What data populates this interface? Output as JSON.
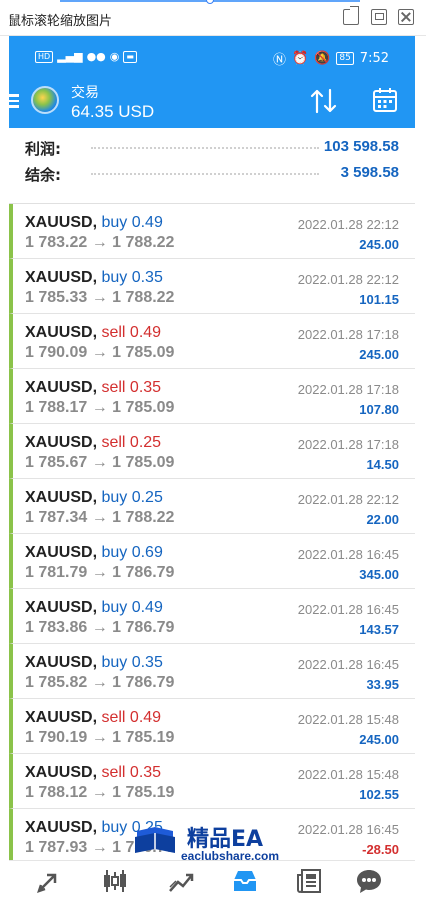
{
  "viewer": {
    "title": "鼠标滚轮缩放图片"
  },
  "status_bar": {
    "left_text": "HD 46 .ıl",
    "time": "7:52",
    "battery": "85"
  },
  "app_bar": {
    "title": "交易",
    "balance": "64.35 USD"
  },
  "summary": {
    "profit_label": "利润:",
    "profit_value": "103 598.58",
    "balance_label": "结余:",
    "balance_value": "3 598.58"
  },
  "orders": [
    {
      "symbol": "XAUUSD,",
      "side": "buy 0.49",
      "type": "buy",
      "prices": "1 783.22 → 1 788.22",
      "time": "2022.01.28 22:12",
      "profit": "245.00"
    },
    {
      "symbol": "XAUUSD,",
      "side": "buy 0.35",
      "type": "buy",
      "prices": "1 785.33 → 1 788.22",
      "time": "2022.01.28 22:12",
      "profit": "101.15"
    },
    {
      "symbol": "XAUUSD,",
      "side": "sell 0.49",
      "type": "sell",
      "prices": "1 790.09 → 1 785.09",
      "time": "2022.01.28 17:18",
      "profit": "245.00"
    },
    {
      "symbol": "XAUUSD,",
      "side": "sell 0.35",
      "type": "sell",
      "prices": "1 788.17 → 1 785.09",
      "time": "2022.01.28 17:18",
      "profit": "107.80"
    },
    {
      "symbol": "XAUUSD,",
      "side": "sell 0.25",
      "type": "sell",
      "prices": "1 785.67 → 1 785.09",
      "time": "2022.01.28 17:18",
      "profit": "14.50"
    },
    {
      "symbol": "XAUUSD,",
      "side": "buy 0.25",
      "type": "buy",
      "prices": "1 787.34 → 1 788.22",
      "time": "2022.01.28 22:12",
      "profit": "22.00"
    },
    {
      "symbol": "XAUUSD,",
      "side": "buy 0.69",
      "type": "buy",
      "prices": "1 781.79 → 1 786.79",
      "time": "2022.01.28 16:45",
      "profit": "345.00"
    },
    {
      "symbol": "XAUUSD,",
      "side": "buy 0.49",
      "type": "buy",
      "prices": "1 783.86 → 1 786.79",
      "time": "2022.01.28 16:45",
      "profit": "143.57"
    },
    {
      "symbol": "XAUUSD,",
      "side": "buy 0.35",
      "type": "buy",
      "prices": "1 785.82 → 1 786.79",
      "time": "2022.01.28 16:45",
      "profit": "33.95"
    },
    {
      "symbol": "XAUUSD,",
      "side": "sell 0.49",
      "type": "sell",
      "prices": "1 790.19 → 1 785.19",
      "time": "2022.01.28 15:48",
      "profit": "245.00"
    },
    {
      "symbol": "XAUUSD,",
      "side": "sell 0.35",
      "type": "sell",
      "prices": "1 788.12 → 1 785.19",
      "time": "2022.01.28 15:48",
      "profit": "102.55"
    },
    {
      "symbol": "XAUUSD,",
      "side": "buy 0.25",
      "type": "buy",
      "prices": "1 787.93 → 1 786.79",
      "time": "2022.01.28 16:45",
      "profit": "-28.50"
    }
  ],
  "watermark": {
    "title": "精品EA",
    "url": "eaclubshare.com"
  },
  "bottom_nav": {
    "items": [
      "quotes-icon",
      "chart-icon",
      "trade-icon",
      "history-icon",
      "news-icon",
      "messages-icon"
    ],
    "active": "history-icon"
  },
  "colors": {
    "accent": "#2196f3",
    "buy": "#1565c0",
    "sell": "#d32f2f",
    "order_bar": "#8bc34a"
  }
}
